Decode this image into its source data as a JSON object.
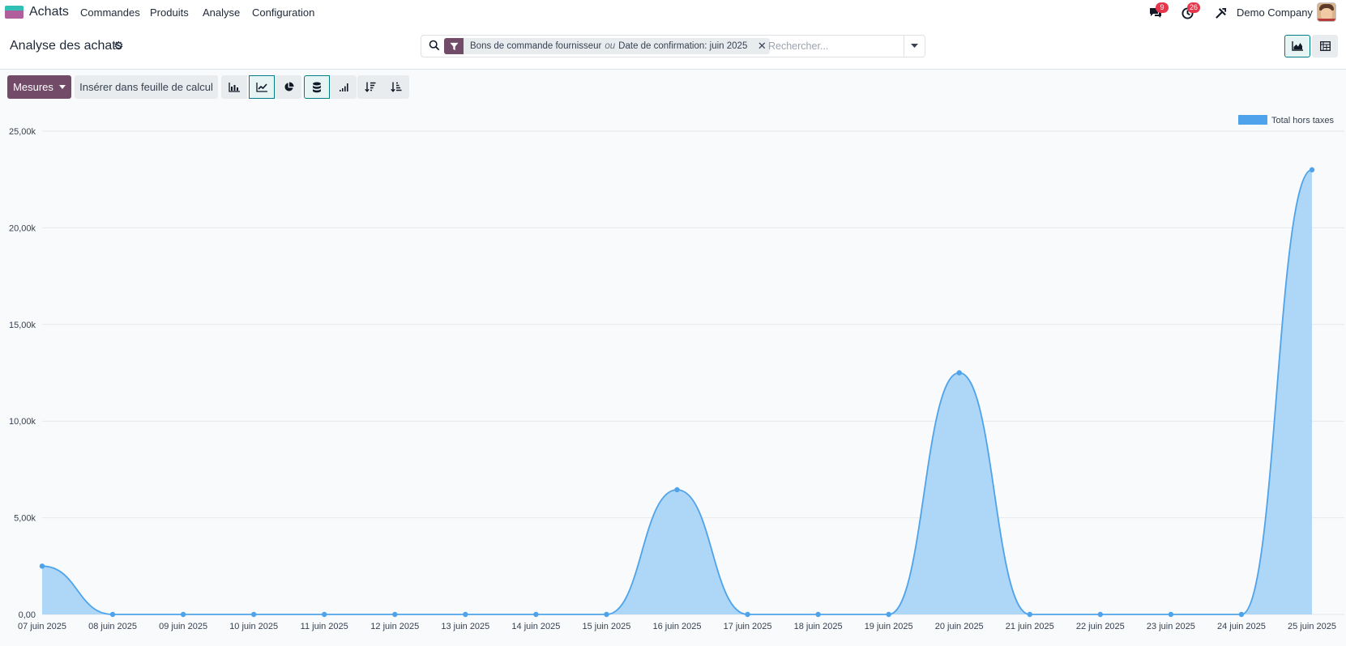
{
  "navbar": {
    "app_name": "Achats",
    "menu": [
      "Commandes",
      "Produits",
      "Analyse",
      "Configuration"
    ],
    "messages_count": "9",
    "activities_count": "26",
    "company": "Demo Company"
  },
  "control_panel": {
    "title": "Analyse des achats",
    "search": {
      "facet_part1": "Bons de commande fournisseur",
      "facet_separator": "ou",
      "facet_part2": "Date de confirmation: juin 2025",
      "placeholder": "Rechercher..."
    }
  },
  "toolbar": {
    "measures_label": "Mesures",
    "insert_label": "Insérer dans feuille de calcul"
  },
  "colors": {
    "brand": "#714b67",
    "accent": "#017e84",
    "series_line": "#4fa3ea",
    "series_fill": "#a9d4f7"
  },
  "chart_data": {
    "type": "area",
    "legend_position": "top-right",
    "grid": true,
    "x": [
      "07 juin 2025",
      "08 juin 2025",
      "09 juin 2025",
      "10 juin 2025",
      "11 juin 2025",
      "12 juin 2025",
      "13 juin 2025",
      "14 juin 2025",
      "15 juin 2025",
      "16 juin 2025",
      "17 juin 2025",
      "18 juin 2025",
      "19 juin 2025",
      "20 juin 2025",
      "21 juin 2025",
      "22 juin 2025",
      "23 juin 2025",
      "24 juin 2025",
      "25 juin 2025"
    ],
    "series": [
      {
        "name": "Total hors taxes",
        "values": [
          2500,
          0,
          0,
          0,
          0,
          0,
          0,
          0,
          0,
          6450,
          0,
          0,
          0,
          12500,
          0,
          0,
          0,
          0,
          23000
        ]
      }
    ],
    "ylim": [
      0,
      25000
    ],
    "yticks": [
      0,
      5000,
      10000,
      15000,
      20000,
      25000
    ],
    "ytick_labels": [
      "0,00",
      "5,00k",
      "10,00k",
      "15,00k",
      "20,00k",
      "25,00k"
    ]
  }
}
